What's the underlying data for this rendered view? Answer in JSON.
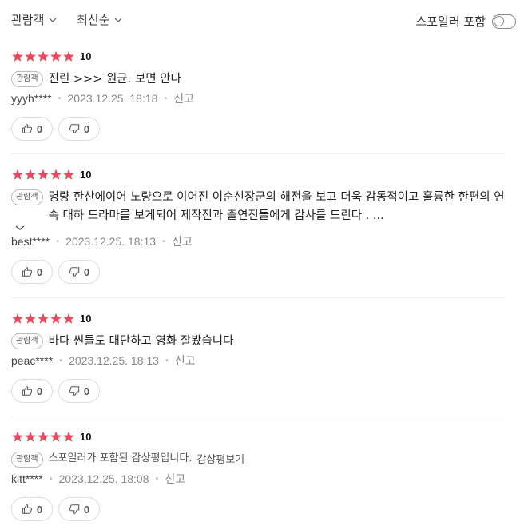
{
  "filters": {
    "audience_label": "관람객",
    "sort_label": "최신순",
    "spoiler_label": "스포일러 포함"
  },
  "colors": {
    "star": "#f0475a"
  },
  "reviews": [
    {
      "score": "10",
      "badge": "관람객",
      "text": "진린 >>> 원균. 보면 안다",
      "user": "yyyh****",
      "date": "2023.12.25. 18:18",
      "report": "신고",
      "likes": "0",
      "dislikes": "0"
    },
    {
      "score": "10",
      "badge": "관람객",
      "text": "명량 한산에이어 노량으로 이어진 이순신장군의 해전을 보고 더욱 감동적이고 훌륭한 한편의 연속 대하 드라마를 보게되어 제작진과 출연진들에게 감사를 드린다 . ...",
      "user": "best****",
      "date": "2023.12.25. 18:13",
      "report": "신고",
      "likes": "0",
      "dislikes": "0"
    },
    {
      "score": "10",
      "badge": "관람객",
      "text": "바다 씬들도 대단하고 영화 잘봤습니다",
      "user": "peac****",
      "date": "2023.12.25. 18:13",
      "report": "신고",
      "likes": "0",
      "dislikes": "0"
    },
    {
      "score": "10",
      "badge": "관람객",
      "spoiler_text": "스포일러가 포함된 감상평입니다.",
      "spoiler_link": "감상평보기",
      "user": "kitt****",
      "date": "2023.12.25. 18:08",
      "report": "신고",
      "likes": "0",
      "dislikes": "0"
    }
  ]
}
